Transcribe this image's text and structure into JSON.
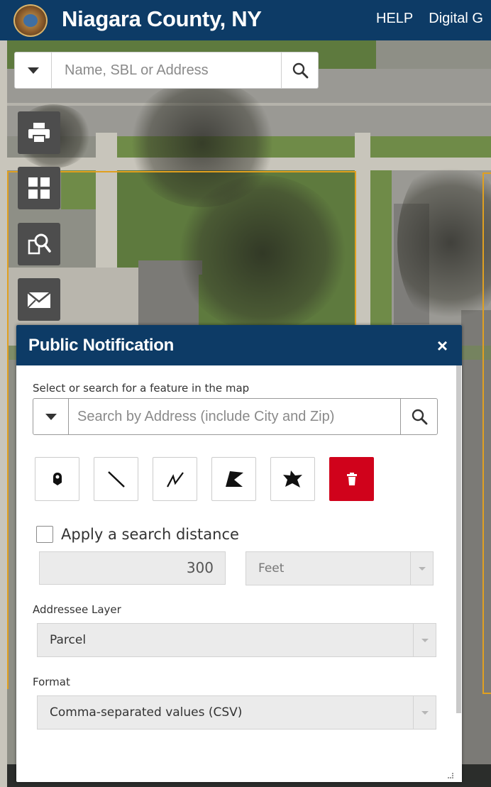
{
  "header": {
    "title": "Niagara County, NY",
    "links": [
      "HELP",
      "Digital G"
    ],
    "logo_icon": "county-seal-logo"
  },
  "search": {
    "placeholder": "Name, SBL or Address",
    "search_icon": "magnifier-icon",
    "dropdown_icon": "caret-down-icon"
  },
  "toolbar": {
    "items": [
      {
        "name": "print",
        "icon": "printer-icon"
      },
      {
        "name": "basemap-gallery",
        "icon": "grid-icon"
      },
      {
        "name": "search-report",
        "icon": "document-search-icon"
      },
      {
        "name": "public-notification",
        "icon": "envelope-icon"
      }
    ]
  },
  "panel": {
    "title": "Public Notification",
    "close_label": "×",
    "select_label": "Select or search for a feature in the map",
    "feature_search_placeholder": "Search by Address (include City and Zip)",
    "draw_tools": [
      "point-icon",
      "line-icon",
      "polyline-icon",
      "polygon-icon",
      "freehand-polygon-icon",
      "trash-icon"
    ],
    "apply_distance_label": "Apply a search distance",
    "apply_distance_checked": false,
    "distance_value": "300",
    "distance_unit": "Feet",
    "addressee_label": "Addressee Layer",
    "addressee_value": "Parcel",
    "format_label": "Format",
    "format_value": "Comma-separated values (CSV)"
  },
  "colors": {
    "header_bg": "#0d3b66",
    "delete_button": "#d0021b",
    "parcel_outline": "#e0a020"
  }
}
